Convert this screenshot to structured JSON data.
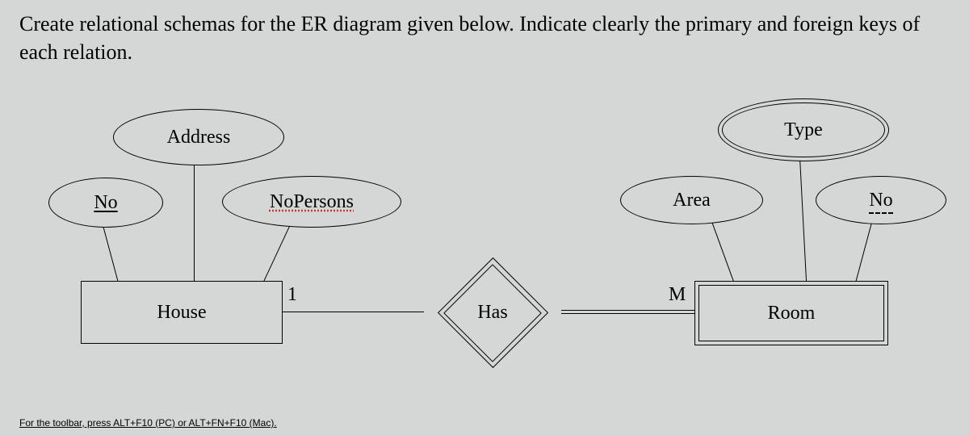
{
  "prompt": "Create relational schemas for the ER diagram given below.  Indicate clearly the primary and foreign keys of each relation.",
  "house": {
    "entity": "House",
    "attrs": {
      "no": "No",
      "address": "Address",
      "nopersons": "NoPersons"
    }
  },
  "room": {
    "entity": "Room",
    "attrs": {
      "area": "Area",
      "type": "Type",
      "no": "No"
    }
  },
  "rel": {
    "name": "Has",
    "left_card": "1",
    "right_card": "M"
  },
  "footer": "For the toolbar, press ALT+F10 (PC) or ALT+FN+F10 (Mac).",
  "er_model": {
    "entities": [
      {
        "name": "House",
        "weak": false,
        "attributes": [
          {
            "name": "No",
            "key": "primary"
          },
          {
            "name": "Address"
          },
          {
            "name": "NoPersons",
            "derived": true
          }
        ]
      },
      {
        "name": "Room",
        "weak": true,
        "attributes": [
          {
            "name": "Area"
          },
          {
            "name": "Type",
            "multivalued": true
          },
          {
            "name": "No",
            "key": "partial"
          }
        ]
      }
    ],
    "relationships": [
      {
        "name": "Has",
        "identifying": true,
        "participants": [
          {
            "entity": "House",
            "cardinality": "1",
            "participation": "partial"
          },
          {
            "entity": "Room",
            "cardinality": "M",
            "participation": "total"
          }
        ]
      }
    ]
  }
}
